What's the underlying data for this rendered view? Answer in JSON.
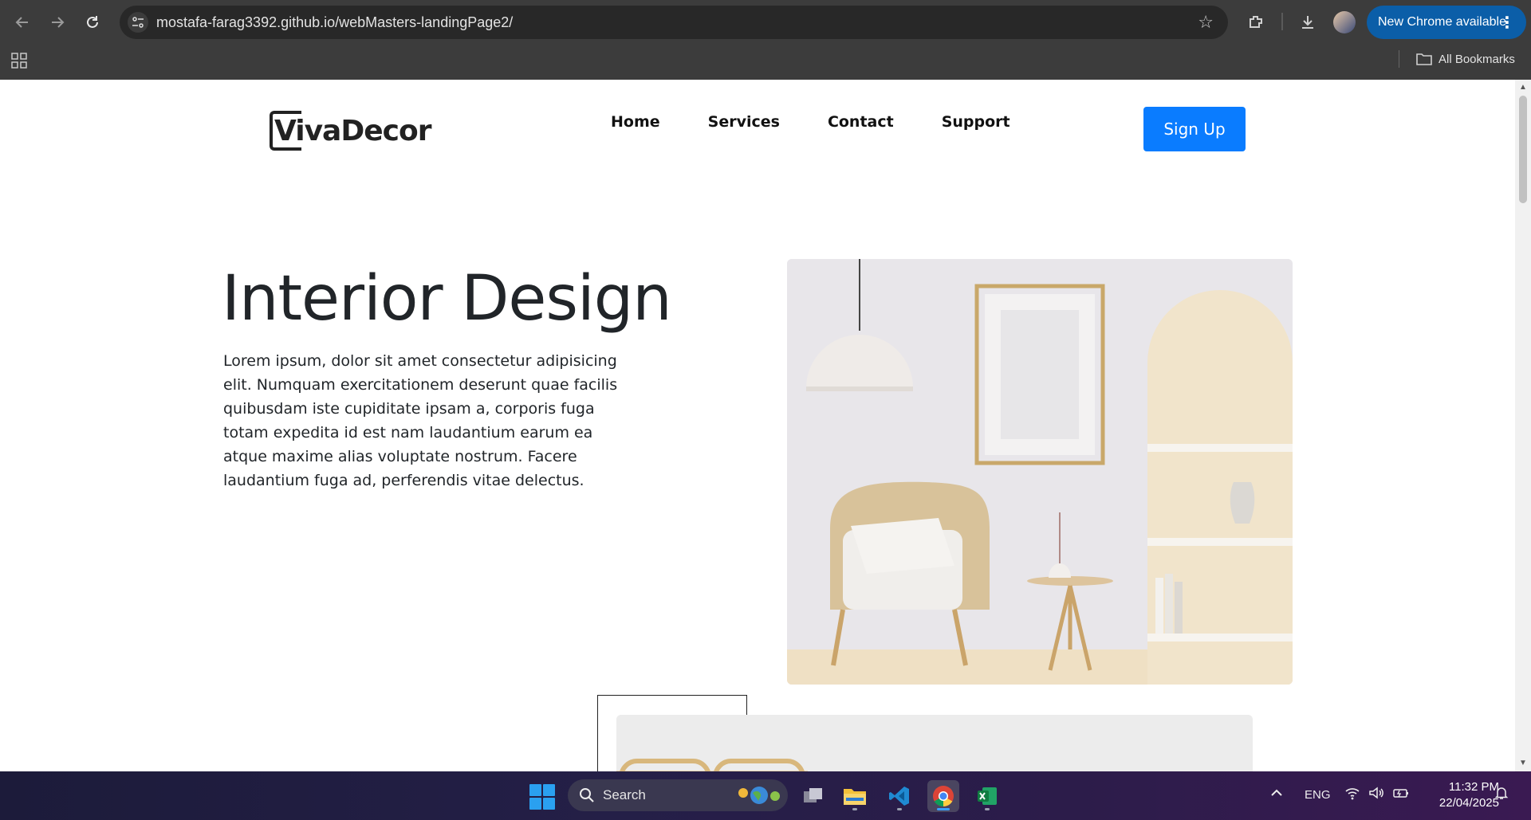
{
  "browser": {
    "url": "mostafa-farag3392.github.io/webMasters-landingPage2/",
    "update_label": "New Chrome available",
    "bookmarks_label": "All Bookmarks"
  },
  "page": {
    "logo": "VivaDecor",
    "nav": [
      {
        "label": "Home"
      },
      {
        "label": "Services"
      },
      {
        "label": "Contact"
      },
      {
        "label": "Support"
      }
    ],
    "signup_label": "Sign Up",
    "hero_title": "Interior Design",
    "hero_text": "Lorem ipsum, dolor sit amet consectetur adipisicing elit. Numquam exercitationem deserunt quae facilis quibusdam iste cupiditate ipsam a, corporis fuga totam expedita id est nam laudantium earum ea atque maxime alias voluptate nostrum. Facere laudantium fuga ad, perferendis vitae delectus.",
    "accent_color": "#0a7cff"
  },
  "taskbar": {
    "search_label": "Search",
    "language": "ENG",
    "time": "11:32 PM",
    "date": "22/04/2025"
  }
}
